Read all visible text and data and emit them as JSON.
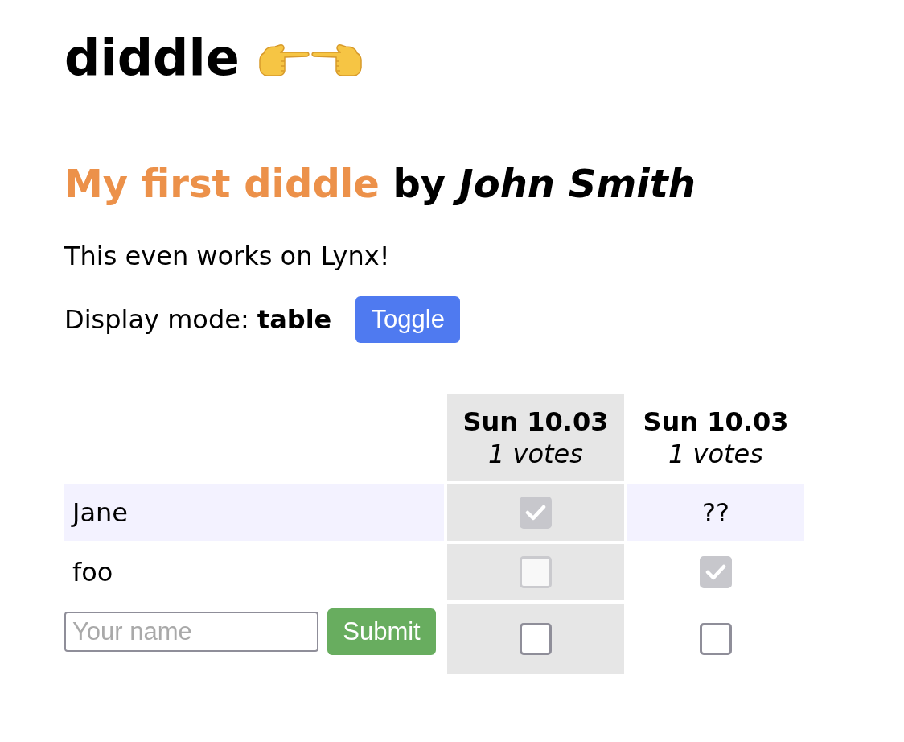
{
  "header": {
    "title": "diddle"
  },
  "poll": {
    "title": "My first diddle",
    "byline": "by *John Smith*",
    "note": "This even works on Lynx!"
  },
  "display_mode": {
    "text": "Display mode: **table**",
    "button": "Toggle"
  },
  "table": {
    "columns": [
      {
        "date": "Sun 10.03",
        "votes": "1 votes",
        "highlighted": true
      },
      {
        "date": "Sun 10.03",
        "votes": "1 votes",
        "highlighted": false
      }
    ],
    "rows": [
      {
        "name": "Jane",
        "highlighted": true,
        "cells": [
          {
            "kind": "checkbox",
            "checked": true,
            "disabled": true
          },
          {
            "kind": "text",
            "text": "??"
          }
        ]
      },
      {
        "name": "foo",
        "highlighted": false,
        "cells": [
          {
            "kind": "checkbox",
            "checked": false,
            "disabled": true
          },
          {
            "kind": "checkbox",
            "checked": true,
            "disabled": true
          }
        ]
      }
    ],
    "new_entry": {
      "placeholder": "Your name",
      "button": "Submit",
      "cells": [
        {
          "kind": "checkbox",
          "checked": false,
          "disabled": false
        },
        {
          "kind": "checkbox",
          "checked": false,
          "disabled": false
        }
      ]
    }
  }
}
